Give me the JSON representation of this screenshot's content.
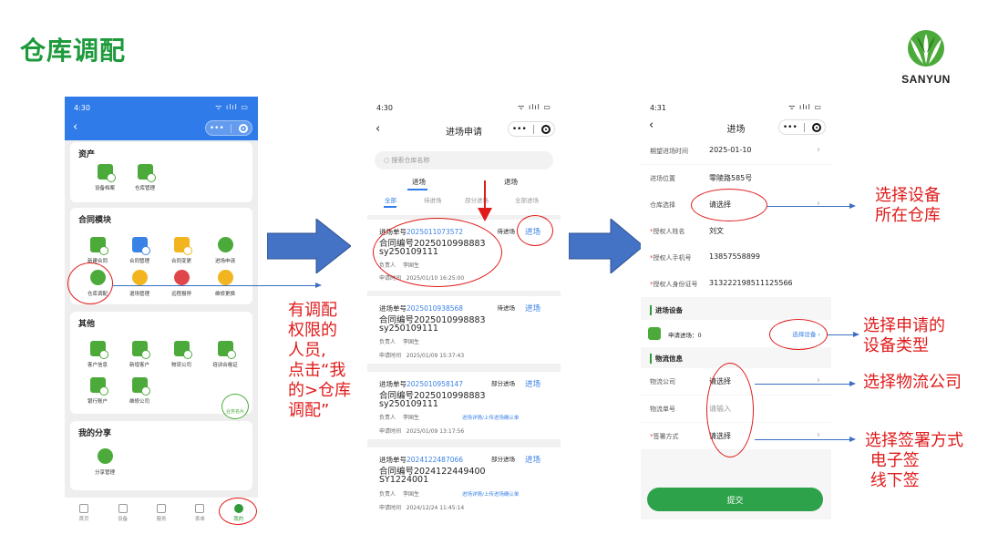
{
  "slide": {
    "title": "仓库调配",
    "brand": "SANYUN",
    "brand_color": "#1e9a3c",
    "annotation_color": "#e01b1b"
  },
  "phone1": {
    "time": "4:30",
    "signal": "ᯤ ılıl ▭",
    "back": "‹",
    "capsule_more": "•••",
    "sections": {
      "assets": {
        "title": "资产",
        "items": [
          {
            "label": "设备档案",
            "color": "green"
          },
          {
            "label": "仓库管理",
            "color": "green"
          }
        ]
      },
      "contract": {
        "title": "合同模块",
        "items": [
          {
            "label": "新建合同",
            "color": "green"
          },
          {
            "label": "合同管理",
            "color": "blue"
          },
          {
            "label": "合同变更",
            "color": "yellow"
          },
          {
            "label": "进场申请",
            "color": "green"
          },
          {
            "label": "仓库调配",
            "color": "green"
          },
          {
            "label": "退场管理",
            "color": "yellow"
          },
          {
            "label": "远程报停",
            "color": "red"
          },
          {
            "label": "维修更换",
            "color": "yellow"
          }
        ]
      },
      "other": {
        "title": "其他",
        "items": [
          {
            "label": "客户信息",
            "color": "green"
          },
          {
            "label": "新增客户",
            "color": "green"
          },
          {
            "label": "物流公司",
            "color": "green"
          },
          {
            "label": "培训合格证",
            "color": "green"
          },
          {
            "label": "银行账户",
            "color": "green"
          },
          {
            "label": "维修公司",
            "color": "green"
          }
        ],
        "badge": "业务名片"
      },
      "share": {
        "title": "我的分享",
        "items": [
          {
            "label": "分享管理",
            "color": "green"
          }
        ]
      }
    },
    "tabs": [
      "首页",
      "设备",
      "服务",
      "表单",
      "我的"
    ]
  },
  "phone2": {
    "time": "4:30",
    "signal": "ᯤ ılıl ▭",
    "back": "‹",
    "title": "进场申请",
    "capsule_more": "•••",
    "search_placeholder": "搜索仓库名称",
    "segments": [
      "进场",
      "退场"
    ],
    "subtabs": [
      "全部",
      "待进场",
      "部分进场",
      "全部进场"
    ],
    "records": [
      {
        "no_label": "进场单号",
        "no": "2025011073572",
        "contract": "合同编号2025010998883",
        "contract2": "sy250109111",
        "status": "待进场",
        "action": "进场",
        "owner_label": "负责人",
        "owner": "李国生",
        "link": "",
        "time_label": "申请时间",
        "time": "2025/01/10 16:25:00"
      },
      {
        "no_label": "进场单号",
        "no": "2025010938568",
        "contract": "合同编号2025010998883",
        "contract2": "sy250109111",
        "status": "待进场",
        "action": "进场",
        "owner_label": "负责人",
        "owner": "李国生",
        "link": "",
        "time_label": "申请时间",
        "time": "2025/01/09 15:37:43"
      },
      {
        "no_label": "进场单号",
        "no": "2025010958147",
        "contract": "合同编号2025010998883",
        "contract2": "sy250109111",
        "status": "部分进场",
        "action": "进场",
        "owner_label": "负责人",
        "owner": "李国生",
        "link": "进场详情/上传进场确认单",
        "time_label": "申请时间",
        "time": "2025/01/09 13:17:56"
      },
      {
        "no_label": "进场单号",
        "no": "2024122487066",
        "contract": "合同编号2024122449400",
        "contract2": "SY1224001",
        "status": "部分进场",
        "action": "进场",
        "owner_label": "负责人",
        "owner": "李国生",
        "link": "进场详情/上传进场确认单",
        "time_label": "申请时间",
        "time": "2024/12/24 11:45:14"
      }
    ]
  },
  "phone3": {
    "time": "4:31",
    "signal": "ᯤ ılıl ▭",
    "back": "‹",
    "title": "进场",
    "capsule_more": "•••",
    "chevron": "›",
    "fields": {
      "expected_date": {
        "label": "期望进场时间",
        "value": "2025-01-10"
      },
      "location": {
        "label": "进场位置",
        "value": "零陵路585号"
      },
      "warehouse": {
        "label": "仓库选择",
        "value": "请选择"
      },
      "auth_name": {
        "label": "授权人姓名",
        "value": "刘文"
      },
      "auth_phone": {
        "label": "授权人手机号",
        "value": "13857558899"
      },
      "auth_id": {
        "label": "授权人身份证号",
        "value": "313222198511125566"
      }
    },
    "device_section": "进场设备",
    "device_apply": "申请进场：0",
    "device_select": "选择设备 ›",
    "logistics_section": "物流信息",
    "logistics": {
      "company": {
        "label": "物流公司",
        "value": "请选择"
      },
      "number": {
        "label": "物流单号",
        "placeholder": "请输入"
      },
      "sign": {
        "label": "签署方式",
        "value": "请选择"
      }
    },
    "submit": "提交"
  },
  "annotations": {
    "note1": [
      "有调配",
      "权限的",
      "人员,",
      "点击“我",
      "的>仓库",
      "调配”"
    ],
    "callout_warehouse": [
      "选择设备",
      "所在仓库"
    ],
    "callout_device": [
      "选择申请的",
      "设备类型"
    ],
    "callout_logistics": [
      "选择物流公司"
    ],
    "callout_sign": [
      "选择签署方式",
      " 电子签",
      " 线下签"
    ]
  }
}
